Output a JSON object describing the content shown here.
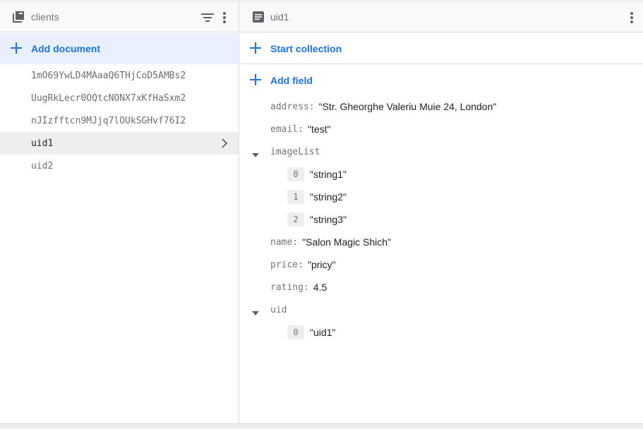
{
  "left": {
    "title": "clients",
    "add_label": "Add document",
    "documents": [
      "1mO69YwLD4MAaaQ6THjCoD5AMBs2",
      "UugRkLecr0OQtcNONX7xKfHaSxm2",
      "nJIzfftcn9MJjq7lOUkSGHvf76I2",
      "uid1",
      "uid2"
    ],
    "selected_index": 3
  },
  "right": {
    "title": "uid1",
    "start_collection_label": "Start collection",
    "add_field_label": "Add field",
    "fields": {
      "address": {
        "key": "address:",
        "value": "\"Str. Gheorghe Valeriu Muie 24, London\""
      },
      "email": {
        "key": "email:",
        "value": "\"test\""
      },
      "imageList": {
        "key": "imageList",
        "items": [
          {
            "index": "0",
            "value": "\"string1\""
          },
          {
            "index": "1",
            "value": "\"string2\""
          },
          {
            "index": "2",
            "value": "\"string3\""
          }
        ]
      },
      "name": {
        "key": "name:",
        "value": "\"Salon Magic Shich\""
      },
      "price": {
        "key": "price:",
        "value": "\"pricy\""
      },
      "rating": {
        "key": "rating:",
        "value": "4.5"
      },
      "uid": {
        "key": "uid",
        "items": [
          {
            "index": "0",
            "value": "\"uid1\""
          }
        ]
      }
    }
  },
  "icons": {
    "collection": "collection-icon",
    "filter": "filter-icon",
    "more": "more-vert-icon",
    "document": "document-icon",
    "add": "add-icon",
    "chevron": "chevron-right-icon",
    "expand": "expand-caret-icon"
  },
  "colors": {
    "accent": "#1a73e8",
    "selected_bg": "#eeeeee",
    "add_bg": "#e8f0fe"
  }
}
